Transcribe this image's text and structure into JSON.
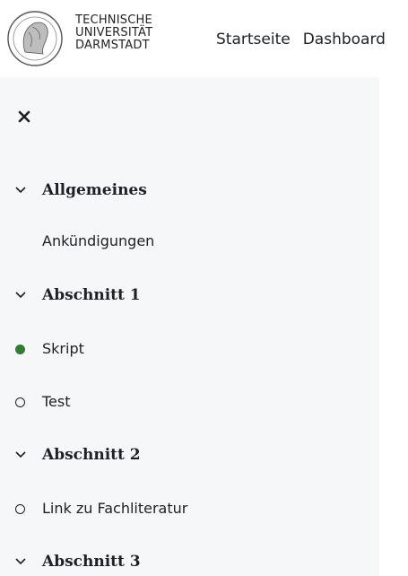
{
  "header": {
    "logo_lines": [
      "TECHNISCHE",
      "UNIVERSITÄT",
      "DARMSTADT"
    ],
    "nav": [
      "Startseite",
      "Dashboard"
    ]
  },
  "drawer": {
    "close_icon": "close-icon",
    "sections": [
      {
        "title": "Allgemeines",
        "expanded": true,
        "items": [
          {
            "label": "Ankündigungen",
            "status": "none"
          }
        ]
      },
      {
        "title": "Abschnitt 1",
        "expanded": true,
        "items": [
          {
            "label": "Skript",
            "status": "done"
          },
          {
            "label": "Test",
            "status": "todo"
          }
        ]
      },
      {
        "title": "Abschnitt 2",
        "expanded": true,
        "items": [
          {
            "label": "Link zu Fachliteratur",
            "status": "todo"
          }
        ]
      },
      {
        "title": "Abschnitt 3",
        "expanded": true,
        "items": []
      }
    ],
    "colors": {
      "done": "#357a32",
      "drawer_bg": "#f6f7f8"
    }
  }
}
